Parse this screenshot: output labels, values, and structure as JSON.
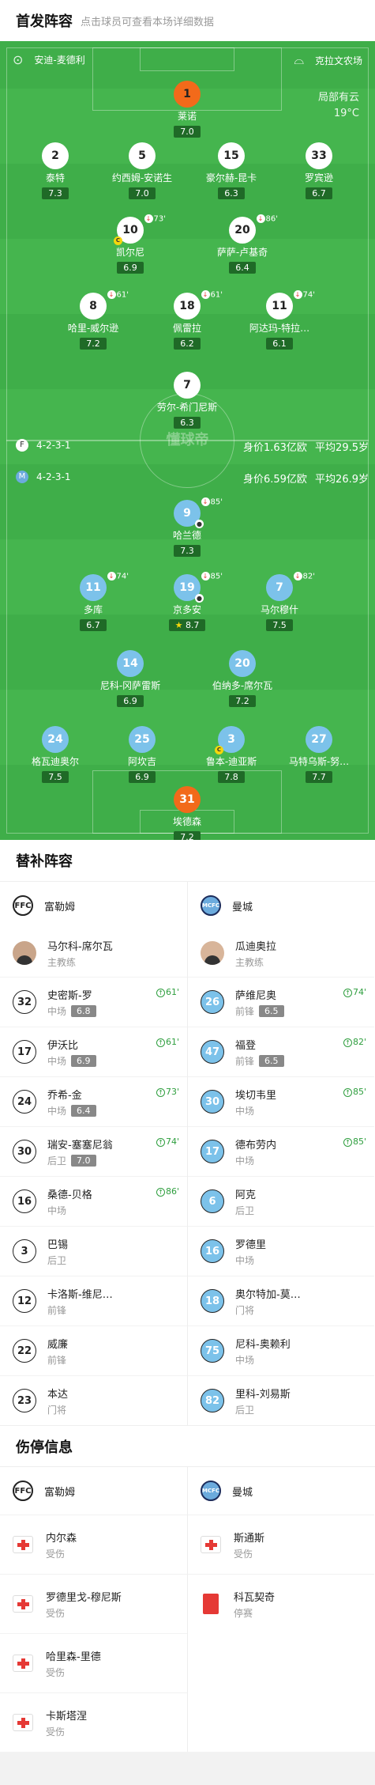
{
  "header": {
    "title": "首发阵容",
    "subtitle": "点击球员可查看本场详细数据"
  },
  "pitch": {
    "home_team": "安迪-麦德利",
    "away_team": "克拉文农场",
    "weather": "局部有云",
    "temperature": "19°C",
    "watermark": "懂球帝",
    "away_formation": "4-2-3-1",
    "away_value": "身价1.63亿欧",
    "away_age": "平均29.5岁",
    "home_formation": "4-2-3-1",
    "home_value": "身价6.59亿欧",
    "home_age": "平均26.9岁"
  },
  "fulham_xi": [
    {
      "num": "1",
      "name": "莱诺",
      "rating": "7.0"
    },
    {
      "num": "2",
      "name": "泰特",
      "rating": "7.3"
    },
    {
      "num": "5",
      "name": "约西姆-安诺生",
      "rating": "7.0"
    },
    {
      "num": "15",
      "name": "豪尔赫-昆卡",
      "rating": "6.3"
    },
    {
      "num": "33",
      "name": "罗宾逊",
      "rating": "6.7"
    },
    {
      "num": "10",
      "name": "凯尔尼",
      "rating": "6.9",
      "sub": "73'"
    },
    {
      "num": "20",
      "name": "萨萨-卢基奇",
      "rating": "6.4",
      "sub": "86'"
    },
    {
      "num": "8",
      "name": "哈里-威尔逊",
      "rating": "7.2",
      "sub": "61'"
    },
    {
      "num": "18",
      "name": "佩雷拉",
      "rating": "6.2",
      "sub": "61'"
    },
    {
      "num": "11",
      "name": "阿达玛-特拉…",
      "rating": "6.1",
      "sub": "74'"
    },
    {
      "num": "7",
      "name": "劳尔-希门尼斯",
      "rating": "6.3"
    }
  ],
  "city_xi": [
    {
      "num": "9",
      "name": "哈兰德",
      "rating": "7.3",
      "sub": "85'"
    },
    {
      "num": "11",
      "name": "多库",
      "rating": "6.7",
      "sub": "74'"
    },
    {
      "num": "19",
      "name": "京多安",
      "rating": "8.7",
      "sub": "85'"
    },
    {
      "num": "7",
      "name": "马尔穆什",
      "rating": "7.5",
      "sub": "82'"
    },
    {
      "num": "14",
      "name": "尼科-冈萨雷斯",
      "rating": "6.9"
    },
    {
      "num": "20",
      "name": "伯纳多-席尔瓦",
      "rating": "7.2"
    },
    {
      "num": "24",
      "name": "格瓦迪奥尔",
      "rating": "7.5"
    },
    {
      "num": "25",
      "name": "阿坎吉",
      "rating": "6.9"
    },
    {
      "num": "3",
      "name": "鲁本-迪亚斯",
      "rating": "7.8"
    },
    {
      "num": "27",
      "name": "马特乌斯-努…",
      "rating": "7.7"
    },
    {
      "num": "31",
      "name": "埃德森",
      "rating": "7.2"
    }
  ],
  "subs_section": {
    "title": "替补阵容"
  },
  "fulham": {
    "name": "富勒姆",
    "crest_label": "FFC",
    "coach": {
      "name": "马尔科-席尔瓦",
      "role": "主教练"
    },
    "subs": [
      {
        "num": "32",
        "name": "史密斯-罗",
        "pos": "中场",
        "rating": "6.8",
        "in": "61'"
      },
      {
        "num": "17",
        "name": "伊沃比",
        "pos": "中场",
        "rating": "6.9",
        "in": "61'"
      },
      {
        "num": "24",
        "name": "乔希-金",
        "pos": "中场",
        "rating": "6.4",
        "in": "73'"
      },
      {
        "num": "30",
        "name": "瑞安-塞塞尼翁",
        "pos": "后卫",
        "rating": "7.0",
        "in": "74'"
      },
      {
        "num": "16",
        "name": "桑德-贝格",
        "pos": "中场",
        "in": "86'"
      },
      {
        "num": "3",
        "name": "巴锡",
        "pos": "后卫"
      },
      {
        "num": "12",
        "name": "卡洛斯-维尼…",
        "pos": "前锋"
      },
      {
        "num": "22",
        "name": "威廉",
        "pos": "前锋"
      },
      {
        "num": "23",
        "name": "本达",
        "pos": "门将"
      }
    ],
    "injuries": [
      {
        "name": "内尔森",
        "status": "受伤",
        "type": "injury"
      },
      {
        "name": "罗德里戈-穆尼斯",
        "status": "受伤",
        "type": "injury"
      },
      {
        "name": "哈里森-里德",
        "status": "受伤",
        "type": "injury"
      },
      {
        "name": "卡斯塔涅",
        "status": "受伤",
        "type": "injury"
      }
    ]
  },
  "city": {
    "name": "曼城",
    "crest_label": "MCFC",
    "coach": {
      "name": "瓜迪奥拉",
      "role": "主教练"
    },
    "subs": [
      {
        "num": "26",
        "name": "萨维尼奥",
        "pos": "前锋",
        "rating": "6.5",
        "in": "74'"
      },
      {
        "num": "47",
        "name": "福登",
        "pos": "前锋",
        "rating": "6.5",
        "in": "82'"
      },
      {
        "num": "30",
        "name": "埃切韦里",
        "pos": "中场",
        "in": "85'"
      },
      {
        "num": "17",
        "name": "德布劳内",
        "pos": "中场",
        "in": "85'"
      },
      {
        "num": "6",
        "name": "阿克",
        "pos": "后卫"
      },
      {
        "num": "16",
        "name": "罗德里",
        "pos": "中场"
      },
      {
        "num": "18",
        "name": "奥尔特加-莫…",
        "pos": "门将"
      },
      {
        "num": "75",
        "name": "尼科-奥赖利",
        "pos": "中场"
      },
      {
        "num": "82",
        "name": "里科-刘易斯",
        "pos": "后卫"
      }
    ],
    "injuries": [
      {
        "name": "斯通斯",
        "status": "受伤",
        "type": "injury"
      },
      {
        "name": "科瓦契奇",
        "status": "停赛",
        "type": "suspension"
      }
    ]
  },
  "injury_section": {
    "title": "伤停信息"
  }
}
